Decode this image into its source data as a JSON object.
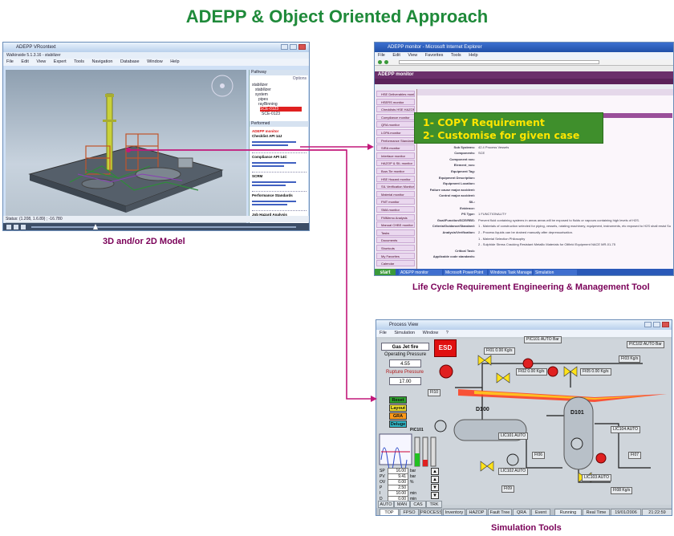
{
  "title": "ADEPP & Object Oriented Approach",
  "captions": {
    "model": "3D and/or 2D Model",
    "lifecycle": "Life Cycle Requirement Engineering & Management Tool",
    "simulation": "Simulation Tools"
  },
  "overlay": {
    "line1": "1- COPY Requirement",
    "line2": "2- Customise for given case"
  },
  "colors": {
    "title": "#1f8a3a",
    "caption": "#7a0058",
    "arrow": "#c2187a",
    "overlay_bg": "#3f8f2c",
    "overlay_text": "#ffe600"
  },
  "model_window": {
    "app_title": "ADEPP VRcontext",
    "file_title": "Walkinside 5.1.3.16 - stabilizer",
    "menu": [
      "File",
      "Edit",
      "View",
      "Expert",
      "Tools",
      "Navigation",
      "Database",
      "Window",
      "Help"
    ],
    "panel_title": "Pathway",
    "options_label": "Options",
    "tree_items": [
      "stabilizer",
      "stabilizer",
      "system",
      "pipes",
      "rayBinning"
    ],
    "selected_item": "SCE-0123",
    "selected_item2": "SCE-0123",
    "panel2_title": "Performed",
    "links": [
      {
        "title": "ADEPP monitor",
        "sub": "Checklist API 14J"
      },
      {
        "title": "Compliance API 14C",
        "sub": ""
      },
      {
        "title": "SCRM",
        "sub": ""
      },
      {
        "title": "Performance Standards",
        "sub": ""
      },
      {
        "title": "Job Hazard Analysis",
        "sub": ""
      }
    ],
    "status_text": "Status: (1.208, 1.6.89) ; -16.780"
  },
  "lcr_window": {
    "title": "ADEPP monitor - Microsoft Internet Explorer",
    "menu": [
      "File",
      "Edit",
      "View",
      "Favorites",
      "Tools",
      "Help"
    ],
    "banner": "ADEPP monitor",
    "side_items": [
      "HSE Deliverables monitor",
      "HSERS monitor",
      "Checklists HSE HAZOP",
      "Compliance monitor",
      "QRA monitor",
      "LOPA monitor",
      "Performance Standards",
      "SIRA monitor",
      "Interface monitor",
      "HAZOP & SIL monitor",
      "Bow-Tie monitor",
      "HSE Hazard monitor",
      "SIL Verification Monitor",
      "Material monitor",
      "FMT monitor",
      "SMA monitor",
      "FMMemo Analysis",
      "Manual CHBS monitor",
      "Tasks",
      "Documents",
      "Shortcuts",
      "My Favorites",
      "Calendar"
    ],
    "fields": [
      {
        "k": "Systems:",
        "v": "42 Hydrocarbon Containment"
      },
      {
        "k": "Sub Systems:",
        "v": "42.4 Process Vessels"
      },
      {
        "k": "Components:",
        "v": "SCE"
      },
      {
        "k": "Component nos:",
        "v": ""
      },
      {
        "k": "Element_nos:",
        "v": ""
      },
      {
        "k": "Equipment Tag:",
        "v": ""
      },
      {
        "k": "Equipment Description:",
        "v": ""
      },
      {
        "k": "Equipment Location:",
        "v": ""
      },
      {
        "k": "Failure cause major accident:",
        "v": ""
      },
      {
        "k": "Control major accident:",
        "v": ""
      },
      {
        "k": "SIL:",
        "v": ""
      },
      {
        "k": "Evidence:",
        "v": ""
      },
      {
        "k": "PS Type:",
        "v": "1 FUNCTIONALITY"
      },
      {
        "k": "Goal/Function/SCE/RBS:",
        "v": "Prevent fluid containing systems in areas areas will be exposed to fluids or vapours containing high levels of H2S."
      },
      {
        "k": "Criteria/Guidance/Standard:",
        "v": "1 - Materials of construction selected for piping, vessels, rotating machinery, equipment, instruments, etc exposed to H2S shall resist Sulphide Stress Cracking."
      },
      {
        "k": "Analysis/Verification:",
        "v": "2 - Process liquids can be drained manually after depressurisation."
      },
      {
        "k": "",
        "v": "1 - Material Selection Philosophy"
      },
      {
        "k": "",
        "v": "2 - Sulphide Stress Cracking Resistant Metallic Materials for Oilfield Equipment NACE MR-01-75"
      },
      {
        "k": "Critical Task:",
        "v": ""
      },
      {
        "k": "Applicable code standards:",
        "v": ""
      }
    ],
    "taskbar": [
      "start",
      "ADEPP monitor",
      "Microsoft PowerPoint",
      "Windows Task Manager",
      "Simulation"
    ]
  },
  "sim_window": {
    "title": "Process View",
    "menu": [
      "File",
      "Simulation",
      "Window",
      "?"
    ],
    "fire_label": "Gas Jet fire",
    "op_pressure_label": "Operating Pressure",
    "op_pressure_value": "4.55",
    "rupture_label": "Rupture Pressure",
    "rupture_value": "17.00",
    "esd_label": "ESD",
    "buttons": [
      "Reset",
      "Layout",
      "GRA",
      "Deluge"
    ],
    "vessel1": "D100",
    "vessel2": "D101",
    "tags": [
      {
        "name": "PIC101",
        "mode": "AUTO",
        "value": "",
        "unit": "Bar"
      },
      {
        "name": "FI01",
        "mode": "",
        "value": "0.00",
        "unit": "Kg/s"
      },
      {
        "name": "FI02",
        "mode": "",
        "value": "0.00",
        "unit": "Kg/s"
      },
      {
        "name": "FI03",
        "mode": "",
        "value": "",
        "unit": "Kg/s"
      },
      {
        "name": "PIC102",
        "mode": "AUTO",
        "value": "",
        "unit": "Bar"
      },
      {
        "name": "FI05",
        "mode": "",
        "value": "0.00",
        "unit": "Kg/s"
      },
      {
        "name": "LIC101",
        "mode": "AUTO",
        "value": "",
        "unit": ""
      },
      {
        "name": "LIC104",
        "mode": "AUTO",
        "value": "",
        "unit": ""
      },
      {
        "name": "FI06",
        "mode": "",
        "value": "",
        "unit": ""
      },
      {
        "name": "LIC102",
        "mode": "AUTO",
        "value": "",
        "unit": ""
      },
      {
        "name": "LIC103",
        "mode": "AUTO",
        "value": "",
        "unit": ""
      },
      {
        "name": "FI07",
        "mode": "",
        "value": "",
        "unit": ""
      },
      {
        "name": "FI08",
        "mode": "",
        "value": "",
        "unit": "Kg/s"
      },
      {
        "name": "FI09",
        "mode": "",
        "value": "",
        "unit": ""
      },
      {
        "name": "FI10",
        "mode": "",
        "value": "",
        "unit": ""
      }
    ],
    "faceplate": {
      "tag": "PIC101",
      "rows": [
        {
          "k": "SP",
          "v": "16.00"
        },
        {
          "k": "PV",
          "v": "9.41"
        },
        {
          "k": "OV",
          "v": "0.00"
        },
        {
          "k": "P",
          "v": "2.50"
        },
        {
          "k": "I",
          "v": "10.00"
        },
        {
          "k": "D",
          "v": "0.00"
        }
      ],
      "units": [
        "bar",
        "bar",
        "%",
        "",
        "min",
        "min"
      ],
      "mode_buttons": [
        "AUTO",
        "MAN"
      ],
      "mode_buttons2": [
        "AUTO",
        "MAN",
        "CAS",
        "TRK"
      ]
    },
    "tabs": [
      "TOP",
      "FPSO",
      "PROCESS",
      "Inventory",
      "HAZOP",
      "Fault Tree",
      "QRA",
      "Event"
    ],
    "running": "Running",
    "real_time": "Real Time",
    "date": "19/01/2006",
    "time": "21:22:59"
  }
}
